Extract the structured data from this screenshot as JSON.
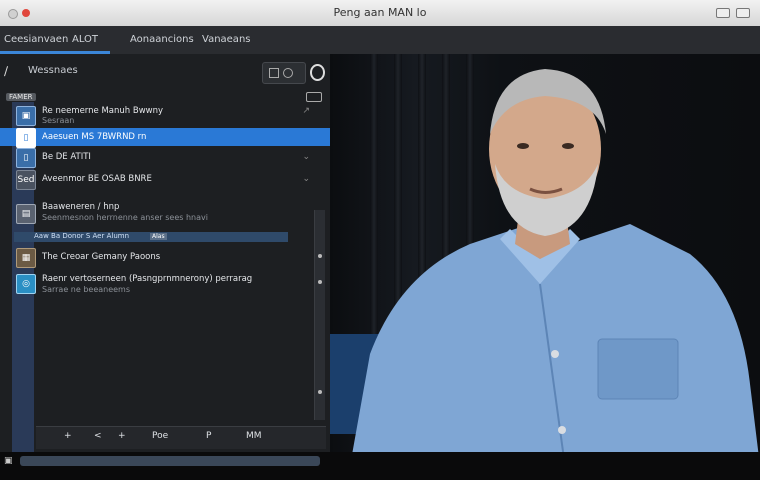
{
  "window": {
    "title": "Peng aan MAN lo"
  },
  "tabs": [
    "Ceesianvaen",
    "ALOT",
    "Aonaancions",
    "Vanaeans"
  ],
  "panel": {
    "title": "Wessnaes",
    "subhead_chip": "FAMER",
    "rows": [
      {
        "line1": "Re neemerne Manuh Bwwny",
        "line2": "Sesraan",
        "icon": "pic"
      },
      {
        "line1": "Aaesuen MS 7BWRND rn",
        "line2": "",
        "icon": "doc",
        "selected": true
      },
      {
        "line1": "Be DE ATITI",
        "line2": "",
        "icon": "doc2"
      },
      {
        "line1": "Aveenmor BE OSAB BNRE",
        "line2": "",
        "icon": "Sed"
      },
      {
        "line1": "Baaweneren / hnp",
        "line2": "Seenmesnon herrnenne anser sees hnavi",
        "icon": "img"
      },
      {
        "line1": "The Creoar Gemany Paoons",
        "line2": "",
        "icon": "pic2"
      },
      {
        "line1": "Raenr vertoserneen (Pasngprnmnerony) perrarag",
        "line2": "Sarrae ne beeaneems",
        "icon": "globe"
      }
    ],
    "separator_text": "Aaw Ba Donor S Aer Alumn",
    "separator_btn": "Alas"
  },
  "bottom_bar": [
    "+",
    "<",
    "+",
    "Poe",
    "P",
    "MM"
  ],
  "colors": {
    "accent": "#2a79d6",
    "panel_bg": "#1d1f22",
    "title_bar": "#e4e4e4"
  }
}
